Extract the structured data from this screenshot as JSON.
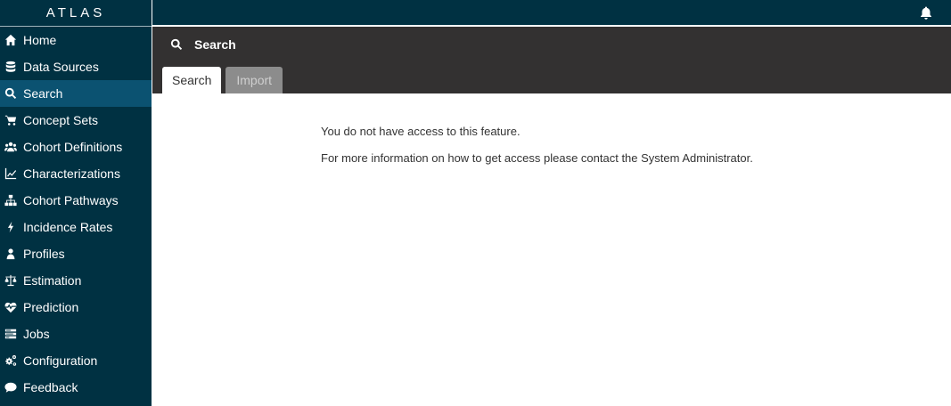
{
  "app": {
    "brand": "ATLAS"
  },
  "sidebar": {
    "items": [
      {
        "label": "Home",
        "icon": "home-icon"
      },
      {
        "label": "Data Sources",
        "icon": "database-icon"
      },
      {
        "label": "Search",
        "icon": "search-icon",
        "active": true
      },
      {
        "label": "Concept Sets",
        "icon": "shopping-cart-icon"
      },
      {
        "label": "Cohort Definitions",
        "icon": "users-icon"
      },
      {
        "label": "Characterizations",
        "icon": "line-chart-icon"
      },
      {
        "label": "Cohort Pathways",
        "icon": "sitemap-icon"
      },
      {
        "label": "Incidence Rates",
        "icon": "bolt-icon"
      },
      {
        "label": "Profiles",
        "icon": "user-icon"
      },
      {
        "label": "Estimation",
        "icon": "balance-scale-icon"
      },
      {
        "label": "Prediction",
        "icon": "heartbeat-icon"
      },
      {
        "label": "Jobs",
        "icon": "tasks-icon"
      },
      {
        "label": "Configuration",
        "icon": "cogs-icon"
      },
      {
        "label": "Feedback",
        "icon": "comment-icon"
      }
    ]
  },
  "topbar": {
    "notification_icon": "bell-icon"
  },
  "header": {
    "title": "Search",
    "tabs": [
      {
        "label": "Search",
        "active": true
      },
      {
        "label": "Import",
        "active": false
      }
    ]
  },
  "main": {
    "message_line1": "You do not have access to this feature.",
    "message_line2": "For more information on how to get access please contact the System Administrator."
  },
  "colors": {
    "sidebar_bg": "#003142",
    "sidebar_active": "#0b5271",
    "header_bg": "#333131",
    "tab_inactive": "#8c8c8c"
  }
}
